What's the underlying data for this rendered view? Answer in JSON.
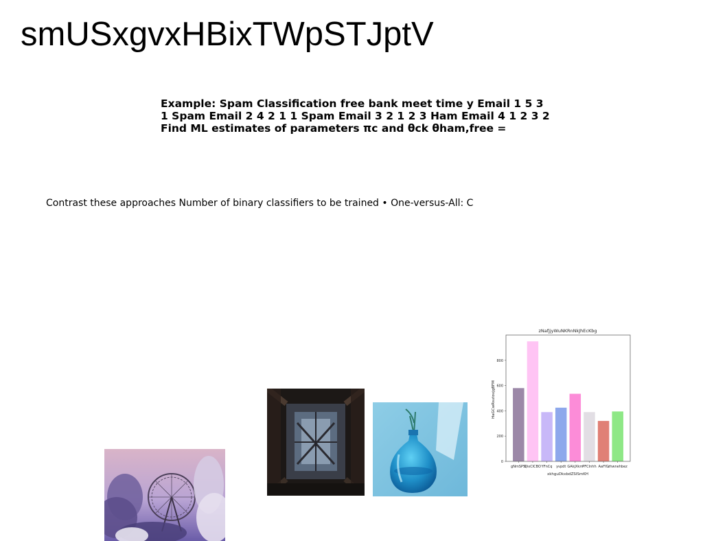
{
  "page": {
    "title": "smUSxgvxHBixTWpSTJptV"
  },
  "example": {
    "lines": [
      "Example: Spam Classification free bank meet time y Email 1 5 3",
      "1 Spam Email 2 4 2 1 1 Spam Email 3 2 1 2 3 Ham Email 4 1 2 3 2",
      "Find ML estimates of parameters πc and θck θham,free ="
    ]
  },
  "contrast": {
    "text": "Contrast these approaches Number of binary classifiers to be trained • One-versus-All: C"
  },
  "images": {
    "ferris_wheel": "ferris-wheel-photo",
    "ruins": "industrial-ruins-photo",
    "vase": "blue-glass-vase-photo"
  },
  "chart_data": {
    "type": "bar",
    "title": "zNafjjyWuNKRnNkJhEcKbg",
    "xlabel": "xkhguDkxbdZSISmKH",
    "ylabel": "HaGCwRsutovjgBFM",
    "categories": [
      "gNmSPSi",
      "QixCICBO",
      "YFnCq",
      "yvpdt",
      "GAkjXkm",
      "PFCInhh",
      "AafYG",
      "zhwnehbez"
    ],
    "values": [
      580,
      950,
      390,
      425,
      535,
      390,
      320,
      395
    ],
    "colors": [
      "#9c88a8",
      "#ffc4f4",
      "#c8b8f8",
      "#8ea8ec",
      "#fc8cd8",
      "#e2dee4",
      "#e08076",
      "#8ee886"
    ],
    "ylim": [
      0,
      1000
    ],
    "yticks": [
      0,
      200,
      400,
      600,
      800
    ],
    "grid": false
  }
}
